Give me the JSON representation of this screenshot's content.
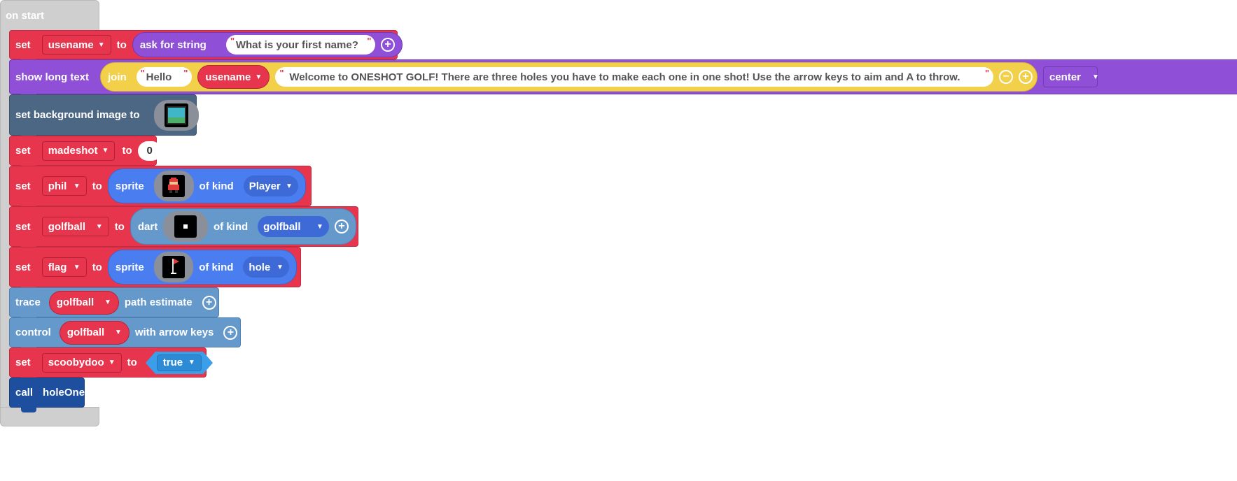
{
  "hat": {
    "label": "on start"
  },
  "blocks": {
    "set_username": {
      "set": "set",
      "var": "usename",
      "to": "to",
      "ask": "ask for string",
      "prompt": "What is your first name?"
    },
    "show_long_text": {
      "label": "show long text",
      "join": "join",
      "str1": "Hello",
      "var": "usename",
      "str2": "Welcome to ONESHOT GOLF! There are three holes you have to make each one in one shot! Use the arrow keys to aim and A to throw.",
      "align": "center"
    },
    "set_bg": {
      "label": "set background image to"
    },
    "set_madeshot": {
      "set": "set",
      "var": "madeshot",
      "to": "to",
      "value": "0"
    },
    "set_phil": {
      "set": "set",
      "var": "phil",
      "to": "to",
      "sprite": "sprite",
      "ofkind": "of kind",
      "kind": "Player"
    },
    "set_golfball": {
      "set": "set",
      "var": "golfball",
      "to": "to",
      "dart": "dart",
      "ofkind": "of kind",
      "kind": "golfball"
    },
    "set_flag": {
      "set": "set",
      "var": "flag",
      "to": "to",
      "sprite": "sprite",
      "ofkind": "of kind",
      "kind": "hole"
    },
    "trace": {
      "trace": "trace",
      "var": "golfball",
      "rest": "path estimate"
    },
    "control": {
      "control": "control",
      "var": "golfball",
      "rest": "with arrow keys"
    },
    "set_scoobydoo": {
      "set": "set",
      "var": "scoobydoo",
      "to": "to",
      "value": "true"
    },
    "call": {
      "call": "call",
      "fn": "holeOne"
    }
  },
  "colors": {
    "variables": "#e8354e",
    "text": "#8f4fd6",
    "join": "#f2d04a",
    "scene": "#4c6784",
    "sprites": "#4a7ef0",
    "controller": "#6599cc",
    "logic": "#3a9fe8",
    "functions": "#1d4f9e",
    "hat": "#cfcfcf"
  }
}
